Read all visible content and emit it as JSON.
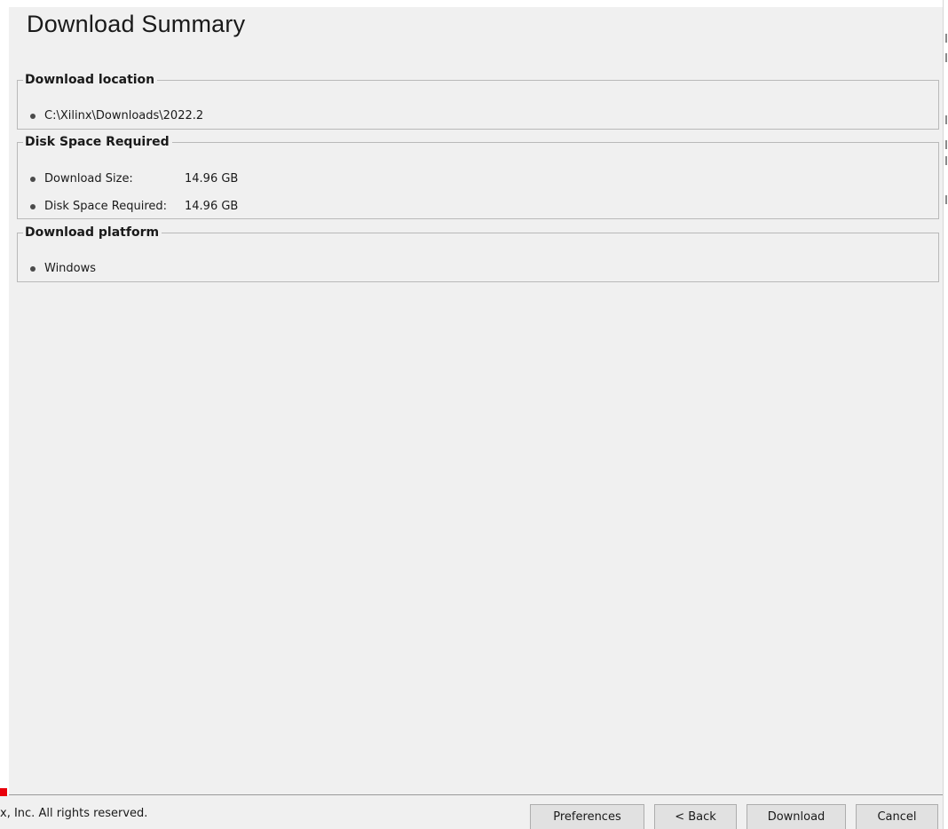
{
  "title": "Download Summary",
  "sections": {
    "location": {
      "legend": "Download location",
      "path": "C:\\Xilinx\\Downloads\\2022.2"
    },
    "disk": {
      "legend": "Disk Space Required",
      "download_size_label": "Download Size:",
      "download_size_value": "14.96 GB",
      "disk_required_label": "Disk Space Required:",
      "disk_required_value": "14.96 GB"
    },
    "platform": {
      "legend": "Download platform",
      "value": "Windows"
    }
  },
  "footer": {
    "copyright": "x, Inc.  All rights reserved.",
    "buttons": {
      "preferences": "Preferences",
      "back": "< Back",
      "download": "Download",
      "cancel": "Cancel"
    }
  },
  "colors": {
    "panel_bg": "#f0f0f0",
    "logo_red": "#e8000b"
  }
}
